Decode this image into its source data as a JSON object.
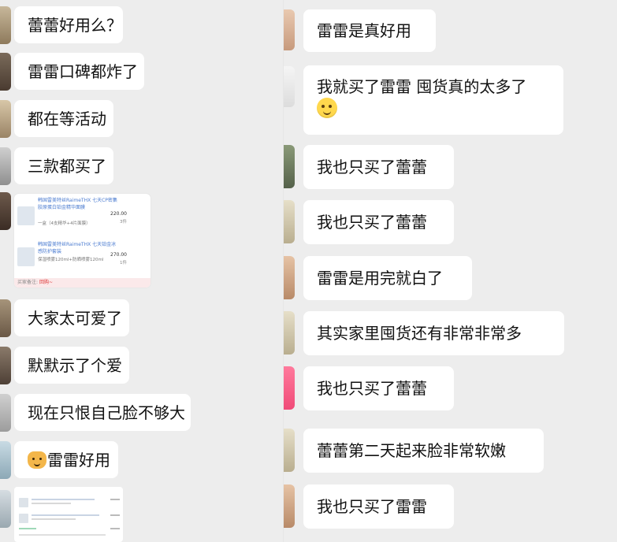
{
  "left_messages": [
    {
      "id": "l1",
      "text": "蕾蕾好用么？"
    },
    {
      "id": "l2",
      "text": "雷雷口碑都炸了"
    },
    {
      "id": "l3",
      "text": "都在等活动"
    },
    {
      "id": "l4",
      "text": "三款都买了"
    },
    {
      "id": "l5",
      "text": "大家太可爱了"
    },
    {
      "id": "l6",
      "text": "默默示了个爱"
    },
    {
      "id": "l7",
      "text": "现在只恨自己脸不够大"
    },
    {
      "id": "l8",
      "text": "雷雷好用",
      "emoji": "cat-face"
    }
  ],
  "order_card": {
    "items": [
      {
        "name": "韩国雷美特丝RaimeTHX 七天CP密集胶原蛋白铂金精华面膜",
        "spec": "一盒（4支精华+4片面膜）",
        "price": "220.00",
        "qty": "3件"
      },
      {
        "name": "韩国雷美特丝RaimeTHX 七天铂金冰感防护套装",
        "spec": "保湿喷雾120ml+防晒喷雾120ml",
        "price": "270.00",
        "qty": "1件"
      }
    ],
    "note_label": "买家备注:",
    "note_text": "回购~"
  },
  "right_messages": [
    {
      "id": "r1",
      "text": "雷雷是真好用"
    },
    {
      "id": "r2",
      "text": "我就买了雷雷 囤货真的太多了",
      "emoji": "crying-face"
    },
    {
      "id": "r3",
      "text": "我也只买了蕾蕾"
    },
    {
      "id": "r4",
      "text": "我也只买了蕾蕾"
    },
    {
      "id": "r5",
      "text": "雷雷是用完就白了"
    },
    {
      "id": "r6",
      "text": "其实家里囤货还有非常非常多"
    },
    {
      "id": "r7",
      "text": "我也只买了蕾蕾"
    },
    {
      "id": "r8",
      "text": "蕾蕾第二天起来脸非常软嫩"
    },
    {
      "id": "r9",
      "text": "我也只买了雷雷"
    }
  ],
  "colors": {
    "background": "#ededed",
    "bubble": "#ffffff",
    "link": "#4a7bd0",
    "note": "#d33"
  }
}
